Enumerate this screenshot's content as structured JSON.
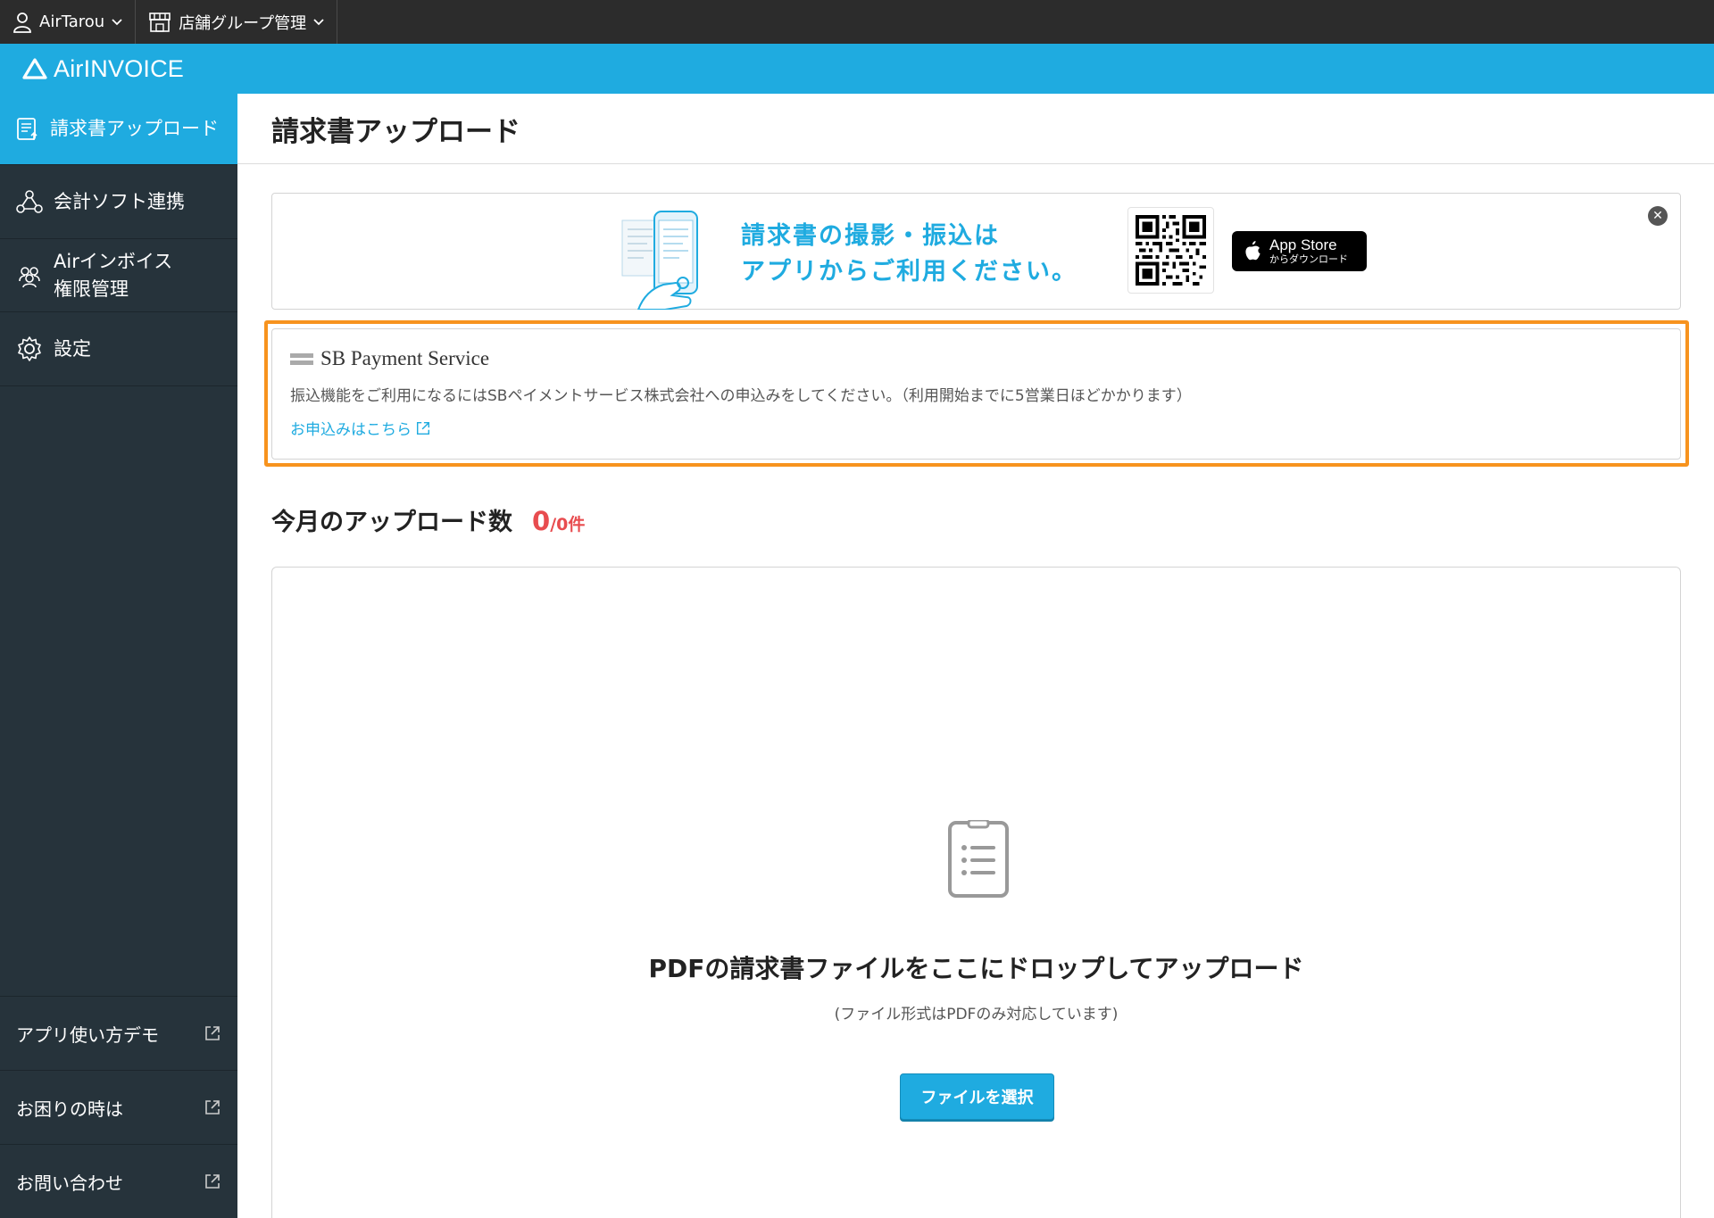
{
  "topbar": {
    "user_label": "AirTarou",
    "store_group_label": "店舗グループ管理"
  },
  "brand": {
    "name": "AirINVOICE",
    "color": "#1fabe0"
  },
  "sidebar": {
    "items": [
      {
        "label": "請求書アップロード",
        "icon": "document-upload-icon",
        "active": true
      },
      {
        "label": "会計ソフト連携",
        "icon": "network-icon",
        "active": false
      },
      {
        "label_line1": "Airインボイス",
        "label_line2": "権限管理",
        "icon": "users-icon",
        "active": false
      },
      {
        "label": "設定",
        "icon": "gear-icon",
        "active": false
      }
    ],
    "bottom_links": [
      {
        "label": "アプリ使い方デモ",
        "icon": "external-link-icon"
      },
      {
        "label": "お困りの時は",
        "icon": "external-link-icon"
      },
      {
        "label": "お問い合わせ",
        "icon": "external-link-icon"
      }
    ]
  },
  "main": {
    "page_title": "請求書アップロード",
    "banner": {
      "text_line1": "請求書の撮影・振込は",
      "text_line2": "アプリからご利用ください。",
      "appstore_line1": "App Store",
      "appstore_line2": "からダウンロード"
    },
    "sb_payment": {
      "logo_text": "SB Payment Service",
      "description": "振込機能をご利用になるにはSBペイメントサービス株式会社への申込みをしてください。（利用開始までに5営業日ほどかかります）",
      "link_label": "お申込みはこちら",
      "highlight_color": "#f7931e"
    },
    "upload_count": {
      "title": "今月のアップロード数",
      "count": "0",
      "suffix": "/0件",
      "color": "#e84c4f"
    },
    "dropzone": {
      "title": "PDFの請求書ファイルをここにドロップしてアップロード",
      "subtitle": "(ファイル形式はPDFのみ対応しています)",
      "button_label": "ファイルを選択"
    }
  }
}
